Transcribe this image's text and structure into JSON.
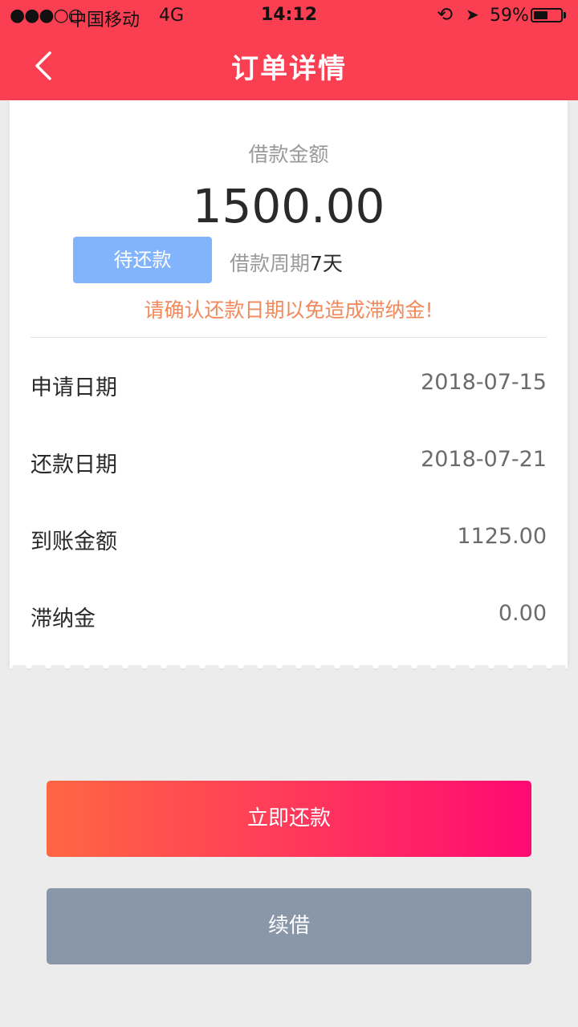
{
  "status_bar": {
    "signal": "●●●○○",
    "carrier": "中国移动",
    "network": "4G",
    "time": "14:12",
    "battery_text": "59%",
    "battery_level": 0.59
  },
  "header": {
    "title": "订单详情",
    "back_icon": "chevron-left-icon",
    "background": "#fa3f52"
  },
  "loan": {
    "amount_label": "借款金额",
    "amount": "1500.00",
    "status": "待还款",
    "period_label": "借款周期",
    "period_value": "7天",
    "warning": "请确认还款日期以免造成滞纳金!"
  },
  "details": [
    {
      "label": "申请日期",
      "value": "2018-07-15"
    },
    {
      "label": "还款日期",
      "value": "2018-07-21"
    },
    {
      "label": "到账金额",
      "value": "1125.00"
    },
    {
      "label": "滞纳金",
      "value": "0.00"
    }
  ],
  "actions": {
    "repay_label": "立即还款",
    "renew_label": "续借"
  },
  "colors": {
    "status_pill": "#82b4fb",
    "warning": "#f08a5d",
    "repay_gradient_start": "#ff6643",
    "repay_gradient_end": "#ff0a72",
    "renew": "#8a97a8"
  }
}
